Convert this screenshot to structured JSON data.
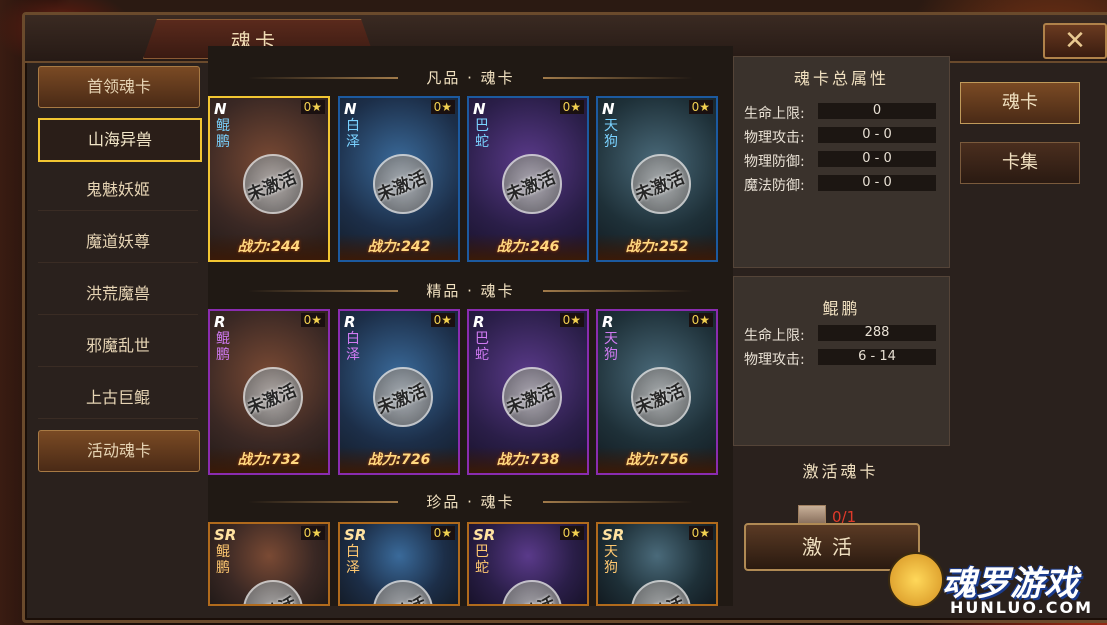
{
  "window": {
    "title": "魂卡",
    "close_icon": "close-icon"
  },
  "leftnav": {
    "items": [
      {
        "label": "首领魂卡"
      },
      {
        "label": "山海异兽"
      },
      {
        "label": "鬼魅妖姬"
      },
      {
        "label": "魔道妖尊"
      },
      {
        "label": "洪荒魔兽"
      },
      {
        "label": "邪魔乱世"
      },
      {
        "label": "上古巨鲲"
      },
      {
        "label": "活动魂卡"
      }
    ]
  },
  "sections": [
    {
      "title": "凡品 · 魂卡",
      "cards": [
        {
          "grade": "N",
          "stars": "0★",
          "name": "鲲鹏",
          "status": "未激活",
          "power": "战力:244"
        },
        {
          "grade": "N",
          "stars": "0★",
          "name": "白泽",
          "status": "未激活",
          "power": "战力:242"
        },
        {
          "grade": "N",
          "stars": "0★",
          "name": "巴蛇",
          "status": "未激活",
          "power": "战力:246"
        },
        {
          "grade": "N",
          "stars": "0★",
          "name": "天狗",
          "status": "未激活",
          "power": "战力:252"
        }
      ]
    },
    {
      "title": "精品 · 魂卡",
      "cards": [
        {
          "grade": "R",
          "stars": "0★",
          "name": "鲲鹏",
          "status": "未激活",
          "power": "战力:732"
        },
        {
          "grade": "R",
          "stars": "0★",
          "name": "白泽",
          "status": "未激活",
          "power": "战力:726"
        },
        {
          "grade": "R",
          "stars": "0★",
          "name": "巴蛇",
          "status": "未激活",
          "power": "战力:738"
        },
        {
          "grade": "R",
          "stars": "0★",
          "name": "天狗",
          "status": "未激活",
          "power": "战力:756"
        }
      ]
    },
    {
      "title": "珍品 · 魂卡",
      "cards": [
        {
          "grade": "SR",
          "stars": "0★",
          "name": "鲲鹏",
          "status": "未激活",
          "power": ""
        },
        {
          "grade": "SR",
          "stars": "0★",
          "name": "白泽",
          "status": "未激活",
          "power": ""
        },
        {
          "grade": "SR",
          "stars": "0★",
          "name": "巴蛇",
          "status": "未激活",
          "power": ""
        },
        {
          "grade": "SR",
          "stars": "0★",
          "name": "天狗",
          "status": "未激活",
          "power": ""
        }
      ]
    }
  ],
  "total_stats": {
    "title": "魂卡总属性",
    "rows": [
      {
        "label": "生命上限:",
        "value": "0"
      },
      {
        "label": "物理攻击:",
        "value": "0 - 0"
      },
      {
        "label": "物理防御:",
        "value": "0 - 0"
      },
      {
        "label": "魔法防御:",
        "value": "0 - 0"
      }
    ]
  },
  "selected_card": {
    "name": "鲲鹏",
    "rows": [
      {
        "label": "生命上限:",
        "value": "288"
      },
      {
        "label": "物理攻击:",
        "value": "6 - 14"
      }
    ]
  },
  "activate": {
    "title": "激活魂卡",
    "count": "0/1",
    "button": "激活"
  },
  "right_tabs": [
    {
      "label": "魂卡"
    },
    {
      "label": "卡集"
    }
  ],
  "logo": {
    "text": "魂罗游戏",
    "sub": "HUNLUO.COM"
  }
}
